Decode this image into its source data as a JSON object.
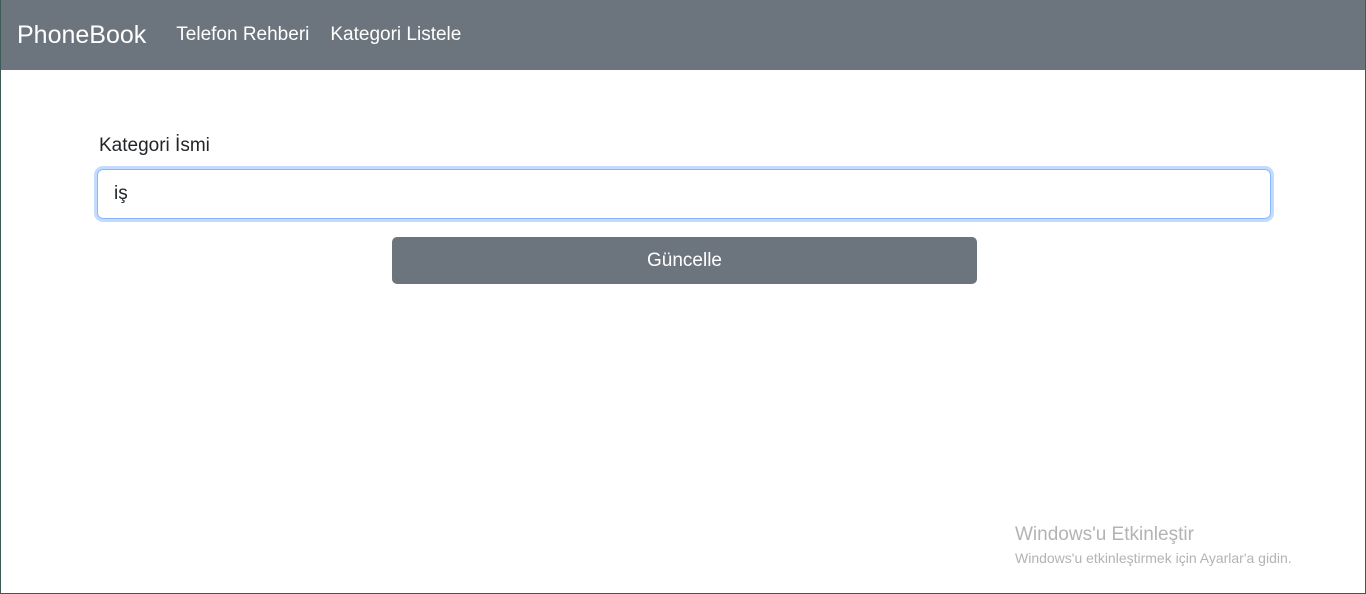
{
  "navbar": {
    "brand": "PhoneBook",
    "links": [
      "Telefon Rehberi",
      "Kategori Listele"
    ]
  },
  "form": {
    "label": "Kategori İsmi",
    "input_value": "iş",
    "submit_label": "Güncelle"
  },
  "watermark": {
    "title": "Windows'u Etkinleştir",
    "subtitle": "Windows'u etkinleştirmek için Ayarlar'a gidin."
  },
  "colors": {
    "navbar_bg": "#6c757d",
    "button_bg": "#6c757d",
    "focus_border": "#86b7fe"
  }
}
